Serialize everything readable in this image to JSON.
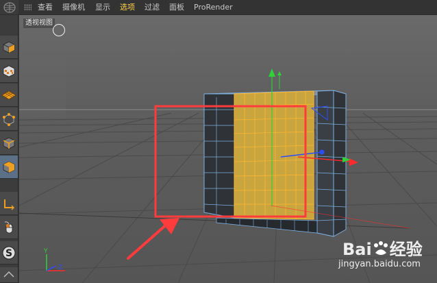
{
  "menu": {
    "items": [
      {
        "label": "查看",
        "active": false
      },
      {
        "label": "摄像机",
        "active": false
      },
      {
        "label": "显示",
        "active": false
      },
      {
        "label": "选项",
        "active": true
      },
      {
        "label": "过滤",
        "active": false
      },
      {
        "label": "面板",
        "active": false
      },
      {
        "label": "ProRender",
        "active": false
      }
    ]
  },
  "viewport": {
    "label": "透视视图",
    "axis_y": "Y",
    "axis_z": "Z"
  },
  "watermark": {
    "brand_left": "Bai",
    "brand_right": "经验",
    "domain": "jingyan.baidu.com"
  },
  "colors": {
    "highlight_red": "#ff3b3b",
    "wire_orange": "#ffb52e",
    "wire_blue": "#7fb0e0",
    "axis_green": "#2fd13a",
    "axis_red": "#ff2a2a",
    "axis_blue": "#2a4dff",
    "active_menu": "#ffd24a"
  },
  "toolbar_icons": [
    "cube-icon",
    "checker-cube-icon",
    "plane-grid-icon",
    "point-mode-icon",
    "edge-mode-icon",
    "polygon-mode-icon",
    "axis-icon",
    "mouse-icon",
    "snap-icon",
    "extra-icon"
  ]
}
